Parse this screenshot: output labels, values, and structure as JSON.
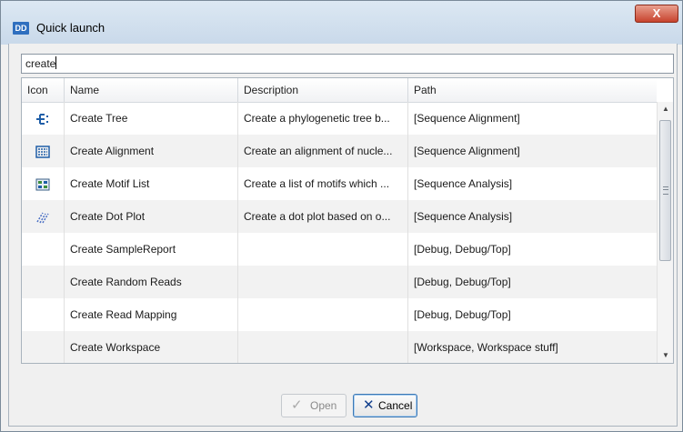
{
  "window": {
    "title": "Quick launch",
    "app_icon_text": "DD",
    "close_glyph": "X"
  },
  "search": {
    "value": "create"
  },
  "table": {
    "columns": [
      "Icon",
      "Name",
      "Description",
      "Path"
    ],
    "rows": [
      {
        "icon": "tree-icon",
        "name": "Create Tree",
        "description": "Create a phylogenetic tree b...",
        "path": "[Sequence Alignment]"
      },
      {
        "icon": "alignment-icon",
        "name": "Create Alignment",
        "description": "Create an alignment of nucle...",
        "path": "[Sequence Alignment]"
      },
      {
        "icon": "motif-list-icon",
        "name": "Create Motif List",
        "description": "Create a list of motifs which ...",
        "path": "[Sequence Analysis]"
      },
      {
        "icon": "dot-plot-icon",
        "name": "Create Dot Plot",
        "description": "Create a dot plot based on o...",
        "path": "[Sequence Analysis]"
      },
      {
        "icon": "",
        "name": "Create SampleReport",
        "description": "",
        "path": "[Debug, Debug/Top]"
      },
      {
        "icon": "",
        "name": "Create Random Reads",
        "description": "",
        "path": "[Debug, Debug/Top]"
      },
      {
        "icon": "",
        "name": "Create Read Mapping",
        "description": "",
        "path": "[Debug, Debug/Top]"
      },
      {
        "icon": "",
        "name": "Create Workspace",
        "description": "",
        "path": "[Workspace, Workspace stuff]"
      }
    ]
  },
  "buttons": {
    "open_label": "Open",
    "open_icon": "check-icon",
    "open_enabled": false,
    "cancel_label": "Cancel",
    "cancel_icon": "x-icon"
  },
  "colors": {
    "accent_blue": "#1f5ea8",
    "row_alt": "#f2f2f2",
    "close_red": "#c7432e"
  }
}
